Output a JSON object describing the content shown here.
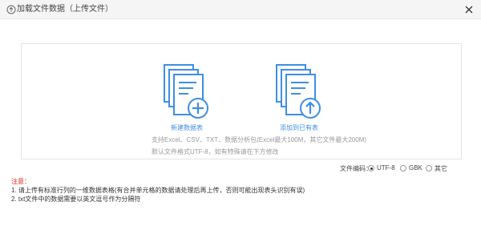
{
  "header": {
    "title": "加载文件数据（上传文件）",
    "title_icon": "upload-cloud-icon",
    "close_icon": "close-icon"
  },
  "upload": {
    "new_label": "新建数据表",
    "new_icon": "document-plus-icon",
    "append_label": "添加到已有表",
    "append_icon": "document-upload-icon",
    "support_text": "支持Excel、CSV、TXT、数据分析包(Excel最大100M，其它文件最大200M)",
    "default_text": "默认文件格式UTF-8，如有特殊请在下方修改"
  },
  "encoding": {
    "label": "文件编码：",
    "options": [
      "UTF-8",
      "GBK",
      "其它"
    ],
    "selected": "UTF-8"
  },
  "notes": {
    "title": "注意：",
    "items": [
      "1. 请上传有标准行列的一维数据表格(有合并单元格的数据请处理后再上传，否则可能出现表头识别有误)",
      "2. txt文件中的数据需要以英文逗号作为分隔符"
    ]
  },
  "colors": {
    "accent": "#3f8ee4",
    "warning": "#e02020",
    "header_bg": "#f5f5f5"
  }
}
